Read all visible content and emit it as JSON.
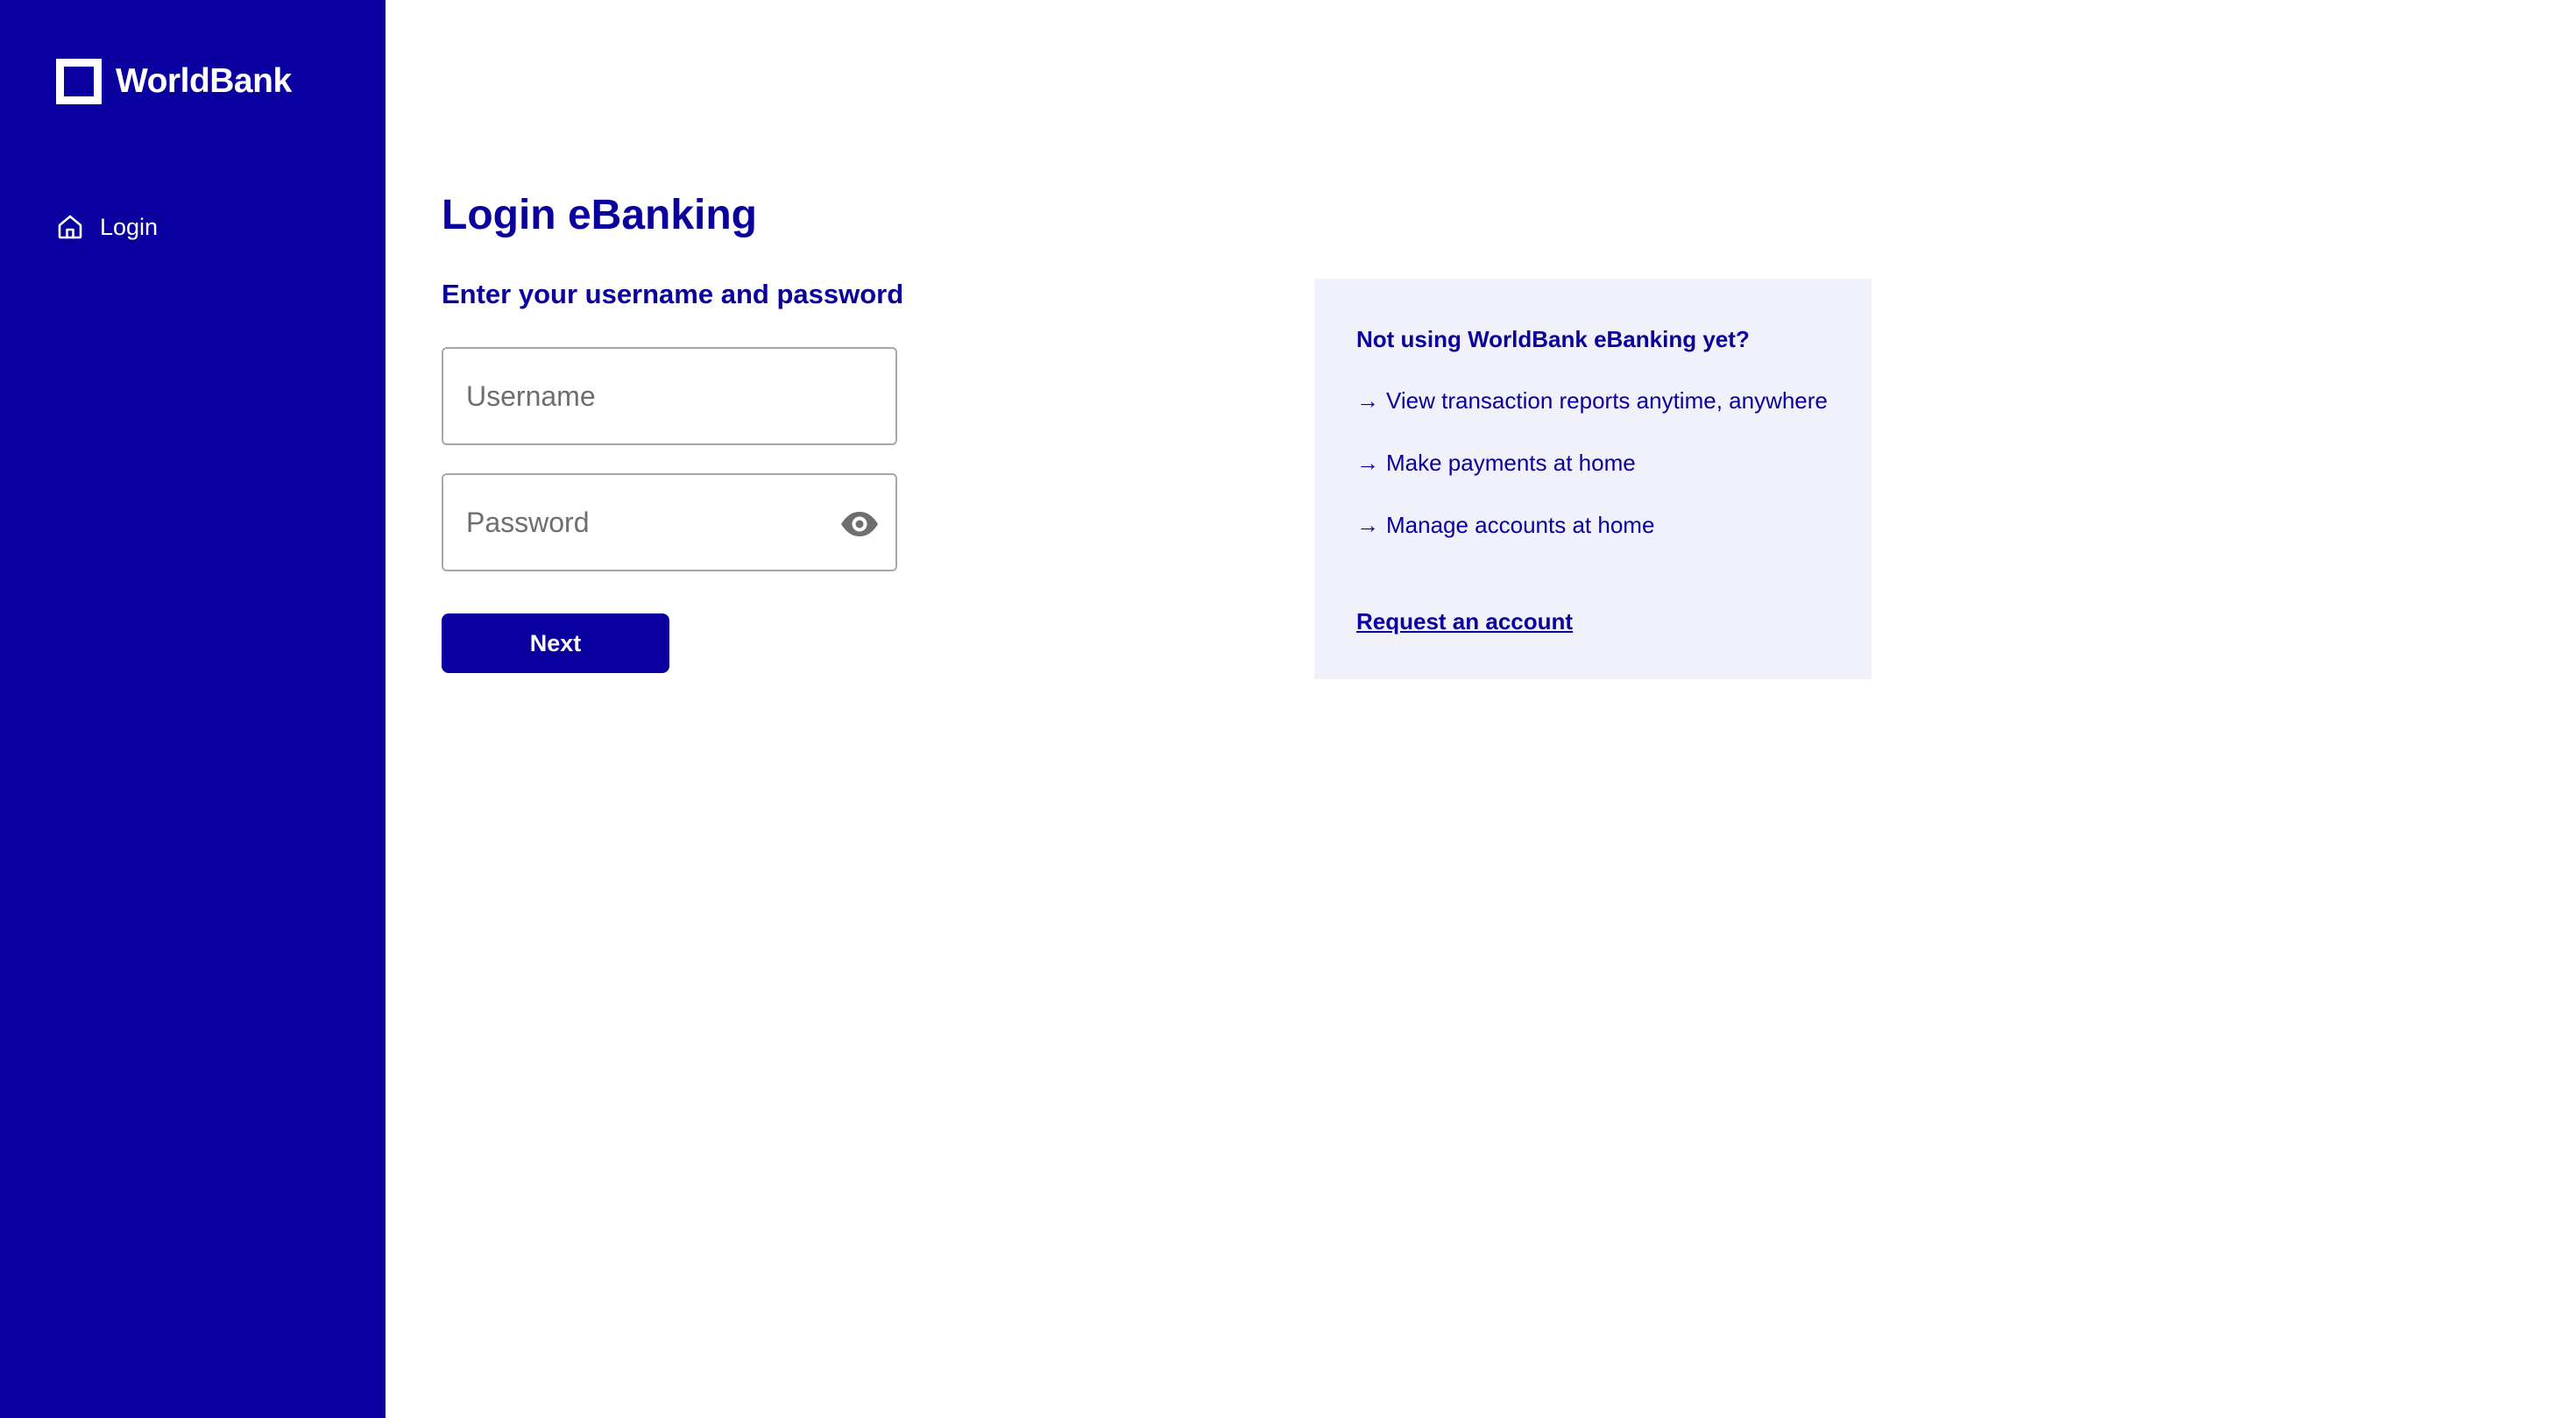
{
  "brand": {
    "name": "WorldBank",
    "logo_icon": "square-outline-icon"
  },
  "sidebar": {
    "items": [
      {
        "label": "Login",
        "icon": "home-icon"
      }
    ]
  },
  "main": {
    "title": "Login eBanking",
    "subtitle": "Enter your username and password",
    "username": {
      "value": "",
      "placeholder": "Username"
    },
    "password": {
      "value": "",
      "placeholder": "Password",
      "toggle_icon": "eye-icon"
    },
    "next_label": "Next"
  },
  "info": {
    "title": "Not using WorldBank eBanking yet?",
    "arrow": "→",
    "benefits": [
      "View transaction reports anytime, anywhere",
      "Make payments at home",
      "Manage accounts at home"
    ],
    "link_label": "Request an account"
  },
  "colors": {
    "primary": "#0a00a0",
    "panel_background": "#f1f1fb",
    "input_border": "#a7a7a7",
    "icon_gray": "#6e6e6e"
  }
}
